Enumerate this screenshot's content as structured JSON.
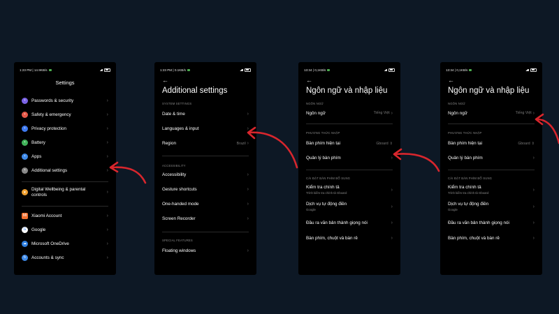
{
  "phone1": {
    "status_time": "1:23 PM | 14.9KB/s",
    "status_right": "",
    "title": "Settings",
    "items": [
      {
        "label": "Passwords & security",
        "color": "#7b63e6",
        "icon": "lock-icon"
      },
      {
        "label": "Safety & emergency",
        "color": "#e65a4a",
        "icon": "safety-icon"
      },
      {
        "label": "Privacy protection",
        "color": "#3f7af0",
        "icon": "privacy-icon"
      },
      {
        "label": "Battery",
        "color": "#41b35a",
        "icon": "battery-icon"
      },
      {
        "label": "Apps",
        "color": "#3f8ae8",
        "icon": "apps-icon"
      },
      {
        "label": "Additional settings",
        "color": "#8a8a8a",
        "icon": "more-icon"
      }
    ],
    "wellbeing": {
      "line1": "Digital Wellbeing & parental",
      "line2": "controls",
      "color": "#f0a030"
    },
    "accounts": [
      {
        "label": "Xiaomi Account",
        "color": "#f07030",
        "icon": "mi-icon",
        "glyph": "MI"
      },
      {
        "label": "Google",
        "color": "#ffffff",
        "icon": "google-icon",
        "glyph": "G"
      },
      {
        "label": "Microsoft OneDrive",
        "color": "#2f7fe0",
        "icon": "onedrive-icon",
        "glyph": "☁"
      },
      {
        "label": "Accounts & sync",
        "color": "#3f8ae8",
        "icon": "sync-icon",
        "glyph": "↻"
      }
    ]
  },
  "phone2": {
    "status_time": "1:23 PM | 0.1KB/s",
    "title": "Additional settings",
    "sec1": "SYSTEM SETTINGS",
    "items1": [
      "Date & time",
      "Languages & input"
    ],
    "region_label": "Region",
    "region_value": "Brazil",
    "sec2": "ACCESSIBILITY",
    "items2": [
      "Accessibility",
      "Gesture shortcuts",
      "One-handed mode",
      "Screen Recorder"
    ],
    "sec3": "SPECIAL FEATURES",
    "items3": [
      "Floating windows"
    ]
  },
  "phone3": {
    "status_time": "13:34 | 0,1KB/s",
    "title": "Ngôn ngữ và nhập liệu",
    "sec1": "NGÔN NGỮ",
    "lang_label": "Ngôn ngữ",
    "lang_value": "Tiếng Việt",
    "sec2": "PHƯƠNG THỨC NHẬP",
    "kb_label": "Bàn phím hiện tại",
    "kb_value": "Gboard",
    "manage_label": "Quản lý bàn phím",
    "sec3": "CÀI ĐẶT BÀN PHÍM BỔ SUNG",
    "spell_label": "Kiểm tra chính tả",
    "spell_sub": "Trình kiểm tra chính tả Gboard",
    "autofill_label": "Dịch vụ tự động điền",
    "autofill_sub": "Google",
    "tts_label": "Đầu ra văn bản thành giọng nói",
    "kbmouse_label": "Bàn phím, chuột và bàn rê"
  },
  "phone4": {
    "status_time": "13:34 | 0,1KB/s",
    "title": "Ngôn ngữ và nhập liệu",
    "sec1": "NGÔN NGỮ",
    "lang_label": "Ngôn ngữ",
    "lang_value": "Tiếng Việt",
    "sec2": "PHƯƠNG THỨC NHẬP",
    "kb_label": "Bàn phím hiện tại",
    "kb_value": "Gboard",
    "manage_label": "Quản lý bàn phím",
    "sec3": "CÀI ĐẶT BÀN PHÍM BỔ SUNG",
    "spell_label": "Kiểm tra chính tả",
    "spell_sub": "Trình kiểm tra chính tả Gboard",
    "autofill_label": "Dịch vụ tự động điền",
    "autofill_sub": "Google",
    "tts_label": "Đầu ra văn bản thành giọng nói",
    "kbmouse_label": "Bàn phím, chuột và bàn rê"
  },
  "colors": {
    "arrow": "#d8262d",
    "background": "#0d1825"
  }
}
